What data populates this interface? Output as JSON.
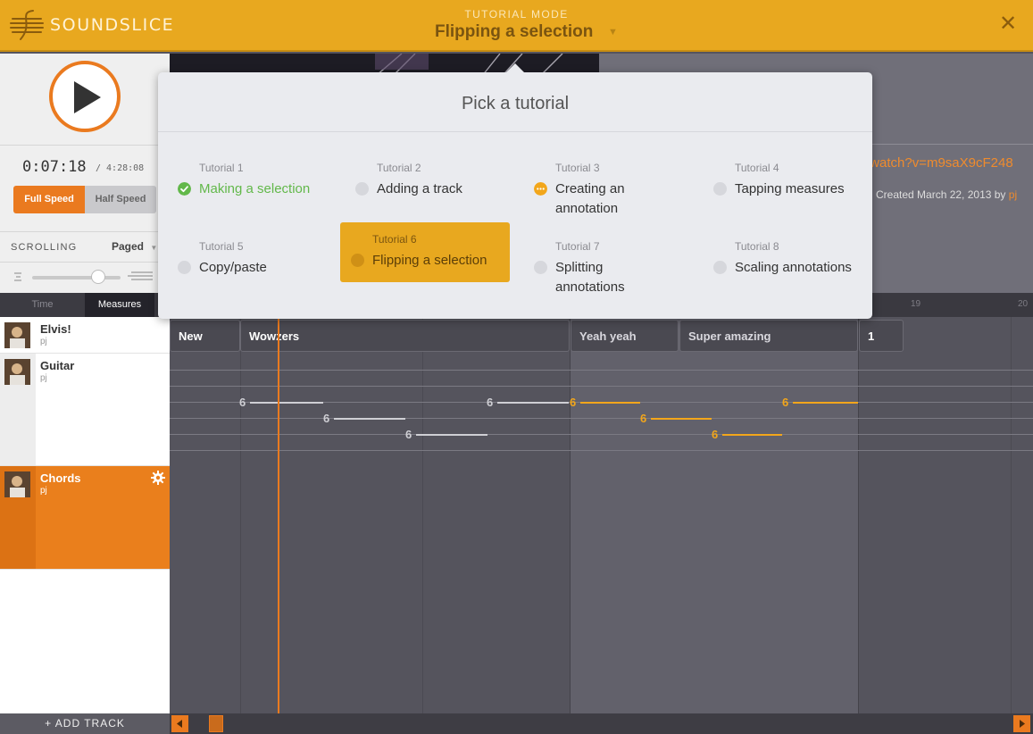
{
  "header": {
    "logo_text": "SOUNDSLICE",
    "mode_label": "TUTORIAL MODE",
    "mode_title": "Flipping a selection",
    "close_glyph": "✕"
  },
  "player": {
    "current_time": "0:07:18",
    "total_time": "/ 4:28:08",
    "speed_full": "Full Speed",
    "speed_half": "Half Speed",
    "scrolling_label": "SCROLLING",
    "scrolling_value": "Paged",
    "zoom_level": 0.75
  },
  "info": {
    "url_fragment": "/watch?v=m9saX9cF248",
    "created_prefix": "Created March 22, 2013 by",
    "created_by": "pj"
  },
  "toggle": {
    "time": "Time",
    "measures": "Measures"
  },
  "ruler": {
    "numbers": [
      "19",
      "20"
    ]
  },
  "tracks": [
    {
      "name": "Elvis!",
      "user": "pj"
    },
    {
      "name": "Guitar",
      "user": "pj"
    },
    {
      "name": "Chords",
      "user": "pj"
    }
  ],
  "add_track": "+ ADD TRACK",
  "sections": {
    "new": "New",
    "wowzers": "Wowzers",
    "yeah": "Yeah yeah",
    "super": "Super amazing",
    "one": "1"
  },
  "notes": {
    "fret": "6"
  },
  "popup": {
    "title": "Pick a tutorial",
    "tutorials": [
      {
        "num": "Tutorial 1",
        "name": "Making a selection",
        "status": "done"
      },
      {
        "num": "Tutorial 2",
        "name": "Adding a track",
        "status": "todo"
      },
      {
        "num": "Tutorial 3",
        "name": "Creating an annotation",
        "status": "in-progress"
      },
      {
        "num": "Tutorial 4",
        "name": "Tapping measures",
        "status": "todo"
      },
      {
        "num": "Tutorial 5",
        "name": "Copy/paste",
        "status": "todo"
      },
      {
        "num": "Tutorial 6",
        "name": "Flipping a selection",
        "status": "active"
      },
      {
        "num": "Tutorial 7",
        "name": "Splitting annotations",
        "status": "todo"
      },
      {
        "num": "Tutorial 8",
        "name": "Scaling annotations",
        "status": "todo"
      }
    ]
  },
  "colors": {
    "brand": "#e8a81f",
    "accent": "#ea7a1f",
    "done": "#62b84a"
  }
}
